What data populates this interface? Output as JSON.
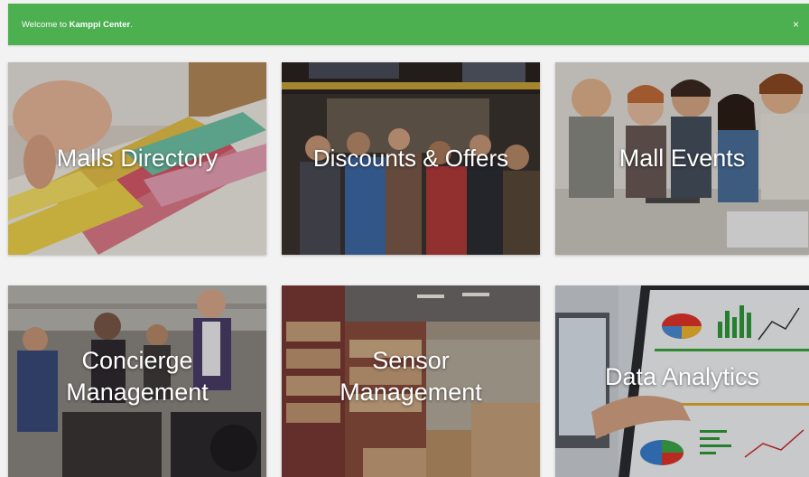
{
  "alert": {
    "text_prefix": "Welcome to ",
    "brand": "Kamppi Center",
    "text_suffix": ".",
    "close_symbol": "×",
    "color": "#4caf50"
  },
  "tiles": [
    {
      "label": "Malls Directory",
      "icon": "file-folders-photo"
    },
    {
      "label": "Discounts & Offers",
      "icon": "shopping-crowd-photo"
    },
    {
      "label": "Mall Events",
      "icon": "young-people-photo"
    },
    {
      "label": "Concierge\nManagement",
      "icon": "concierge-staff-photo"
    },
    {
      "label": "Sensor\nManagement",
      "icon": "warehouse-photo"
    },
    {
      "label": "Data Analytics",
      "icon": "analytics-screen-photo"
    }
  ]
}
